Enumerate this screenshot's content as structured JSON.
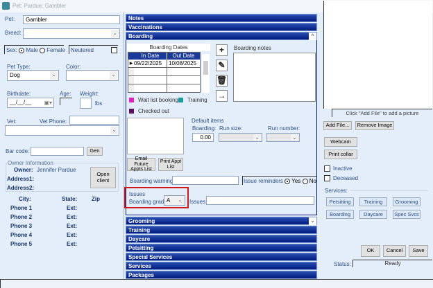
{
  "window": {
    "title": "Pet: Pardue: Gambler"
  },
  "pet": {
    "pet_label": "Pet:",
    "pet_value": "Gambler",
    "breed_label": "Breed:",
    "breed_value": "",
    "sex_label": "Sex:",
    "sex_male": "Male",
    "sex_female": "Female",
    "sex_selected": "Male",
    "neutered_label": "Neutered",
    "pet_type_label": "Pet Type:",
    "pet_type_value": "Dog",
    "color_label": "Color:",
    "color_value": "",
    "birthdate_label": "Birthdate:",
    "birthdate_value": "__/__/__",
    "age_label": "Age:",
    "weight_label": "Weight:",
    "weight_unit": "lbs",
    "vet_label": "Vet:",
    "vet_phone_label": "Vet Phone:",
    "barcode_label": "Bar code:",
    "gen_button": "Gen"
  },
  "owner": {
    "group_label": "Owner Information",
    "owner_label": "Owner:",
    "owner_value": "Jennifer Pardue",
    "address1_label": "Address1:",
    "address2_label": "Address2:",
    "open_client_button": "Open client",
    "city_label": "City:",
    "state_label": "State:",
    "zip_label": "Zip",
    "phones": [
      {
        "label": "Phone 1",
        "ext": "Ext:"
      },
      {
        "label": "Phone 2",
        "ext": "Ext:"
      },
      {
        "label": "Phone 3",
        "ext": "Ext:"
      },
      {
        "label": "Phone 4",
        "ext": "Ext:"
      },
      {
        "label": "Phone 5",
        "ext": "Ext:"
      }
    ]
  },
  "sections_top": [
    "Notes",
    "Vaccinations",
    "Boarding"
  ],
  "sections_bottom": [
    "Grooming",
    "Training",
    "Daycare",
    "Petsitting",
    "Special Services",
    "Services",
    "Packages"
  ],
  "boarding": {
    "dates_title": "Boarding Dates",
    "col_in": "In Date",
    "col_out": "Out Date",
    "rows": [
      {
        "in": "09/22/2025",
        "out": "10/08/2025"
      },
      {
        "in": "",
        "out": ""
      },
      {
        "in": "",
        "out": ""
      },
      {
        "in": "",
        "out": ""
      }
    ],
    "notes_label": "Boarding notes",
    "legend": [
      {
        "label": "Wait list booking",
        "color": "#e020c0"
      },
      {
        "label": "Training",
        "color": "#1a9a9a"
      },
      {
        "label": "Checked out",
        "color": "#5a1060"
      }
    ],
    "email_button": "Email Future Appts List",
    "print_button": "Print Appt List",
    "default_items_label": "Default items",
    "boarding_label": "Boarding:",
    "boarding_value": "0.00",
    "run_size_label": "Run size:",
    "run_number_label": "Run number:",
    "warning_label": "Boarding warning:",
    "reminders_label": "Issue reminders",
    "yes": "Yes",
    "no": "No",
    "issues_group": "Issues",
    "grade_label": "Boarding grade:",
    "grade_value": "A",
    "issues_label": "Issues:"
  },
  "right": {
    "picture_hint": "Click \"Add File\" to add a picture",
    "add_file": "Add File...",
    "remove_image": "Remove Image",
    "webcam": "Webcam",
    "print_collar": "Print collar",
    "inactive": "Inactive",
    "deceased": "Deceased",
    "services_label": "Services:",
    "services": [
      "Petsitting",
      "Training",
      "Grooming",
      "Boarding",
      "Daycare",
      "Spec Svcs"
    ],
    "ok": "OK",
    "cancel": "Cancel",
    "save": "Save",
    "status_label": "Status:",
    "status_value": "Ready"
  }
}
